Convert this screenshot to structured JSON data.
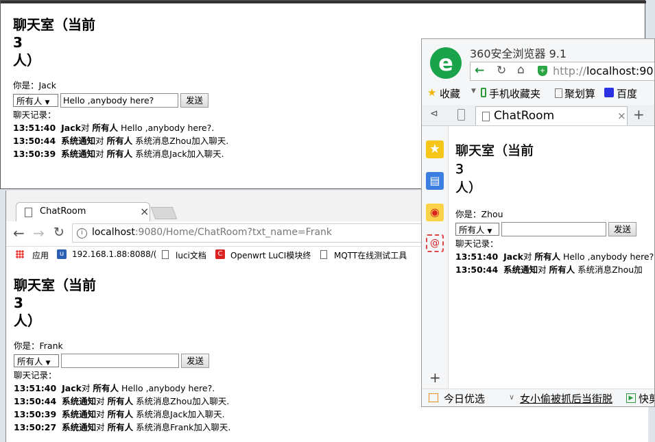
{
  "common": {
    "title_line1": "聊天室（当前",
    "title_count": "3",
    "title_line3": "人）",
    "history_label": "聊天记录：",
    "target_option": "所有人",
    "send_label": "发送",
    "dropdown_arrow": "▼",
    "to_word": "对"
  },
  "window_jack": {
    "you_are": "你是：Jack",
    "message_value": "Hello ,anybody here?",
    "messages": [
      {
        "time": "13:51:40",
        "sender": "Jack",
        "target": "所有人",
        "text": "Hello ,anybody here?."
      },
      {
        "time": "13:50:44",
        "sender": "系统通知",
        "target": "所有人",
        "text": "系统消息Zhou加入聊天."
      },
      {
        "time": "13:50:39",
        "sender": "系统通知",
        "target": "所有人",
        "text": "系统消息Jack加入聊天."
      }
    ]
  },
  "window_frank": {
    "tab_title": "ChatRoom",
    "tab_close": "×",
    "url_host": "localhost",
    "url_rest": ":9080/Home/ChatRoom?txt_name=Frank",
    "bookmarks": [
      "应用",
      "192.168.1.88:8088/(",
      "luci文档",
      "Openwrt LuCI模块终",
      "MQTT在线测试工具"
    ],
    "you_are": "你是：Frank",
    "messages": [
      {
        "time": "13:51:40",
        "sender": "Jack",
        "target": "所有人",
        "text": "Hello ,anybody here?."
      },
      {
        "time": "13:50:44",
        "sender": "系统通知",
        "target": "所有人",
        "text": "系统消息Zhou加入聊天."
      },
      {
        "time": "13:50:39",
        "sender": "系统通知",
        "target": "所有人",
        "text": "系统消息Jack加入聊天."
      },
      {
        "time": "13:50:27",
        "sender": "系统通知",
        "target": "所有人",
        "text": "系统消息Frank加入聊天."
      }
    ]
  },
  "window_zhou": {
    "browser_name": "360安全浏览器 9.1",
    "url_prefix": "http://",
    "url_host": "localhost",
    "url_rest": ":90",
    "bookmarks": [
      "收藏",
      "手机收藏夹",
      "聚划算",
      "百度"
    ],
    "tab_title": "ChatRoom",
    "tab_close": "×",
    "new_tab": "+",
    "you_are": "你是：Zhou",
    "messages": [
      {
        "time": "13:51:40",
        "sender": "Jack",
        "target": "所有人",
        "text": "Hello ,anybody here?."
      },
      {
        "time": "13:50:44",
        "sender": "系统通知",
        "target": "所有人",
        "text": "系统消息Zhou加"
      }
    ],
    "status_today": "今日优选",
    "status_news": "女小偷被抓后当街脱",
    "status_fast": "快剪"
  }
}
